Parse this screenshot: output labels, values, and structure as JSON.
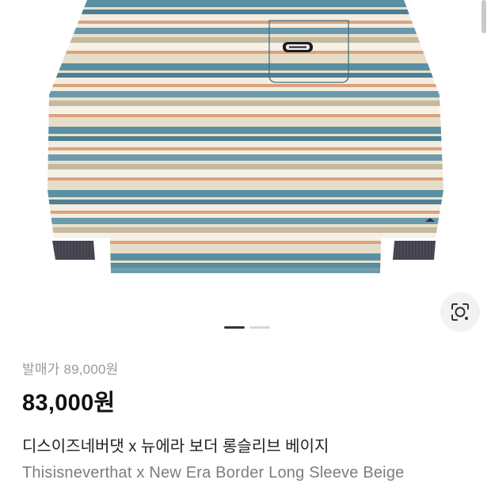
{
  "product": {
    "original_price_label": "발매가 89,000원",
    "price": "83,000원",
    "name_ko": "디스이즈네버댓 x 뉴에라 보더 롱슬리브 베이지",
    "name_en": "Thisisneverthat x New Era Border Long Sleeve Beige",
    "image": {
      "subject": "striped long sleeve shirt",
      "stripe_colors": [
        "#5b8fa3",
        "#e8e1cb",
        "#d9a37e",
        "#f2ede0",
        "#4f7f95",
        "#c7b9a0"
      ],
      "cuff_color": "#4a4b57",
      "pocket_logo": "thisisneverthat"
    }
  },
  "carousel": {
    "total": 2,
    "active_index": 1
  },
  "icons": {
    "visual_search": "lens-camera-icon"
  }
}
